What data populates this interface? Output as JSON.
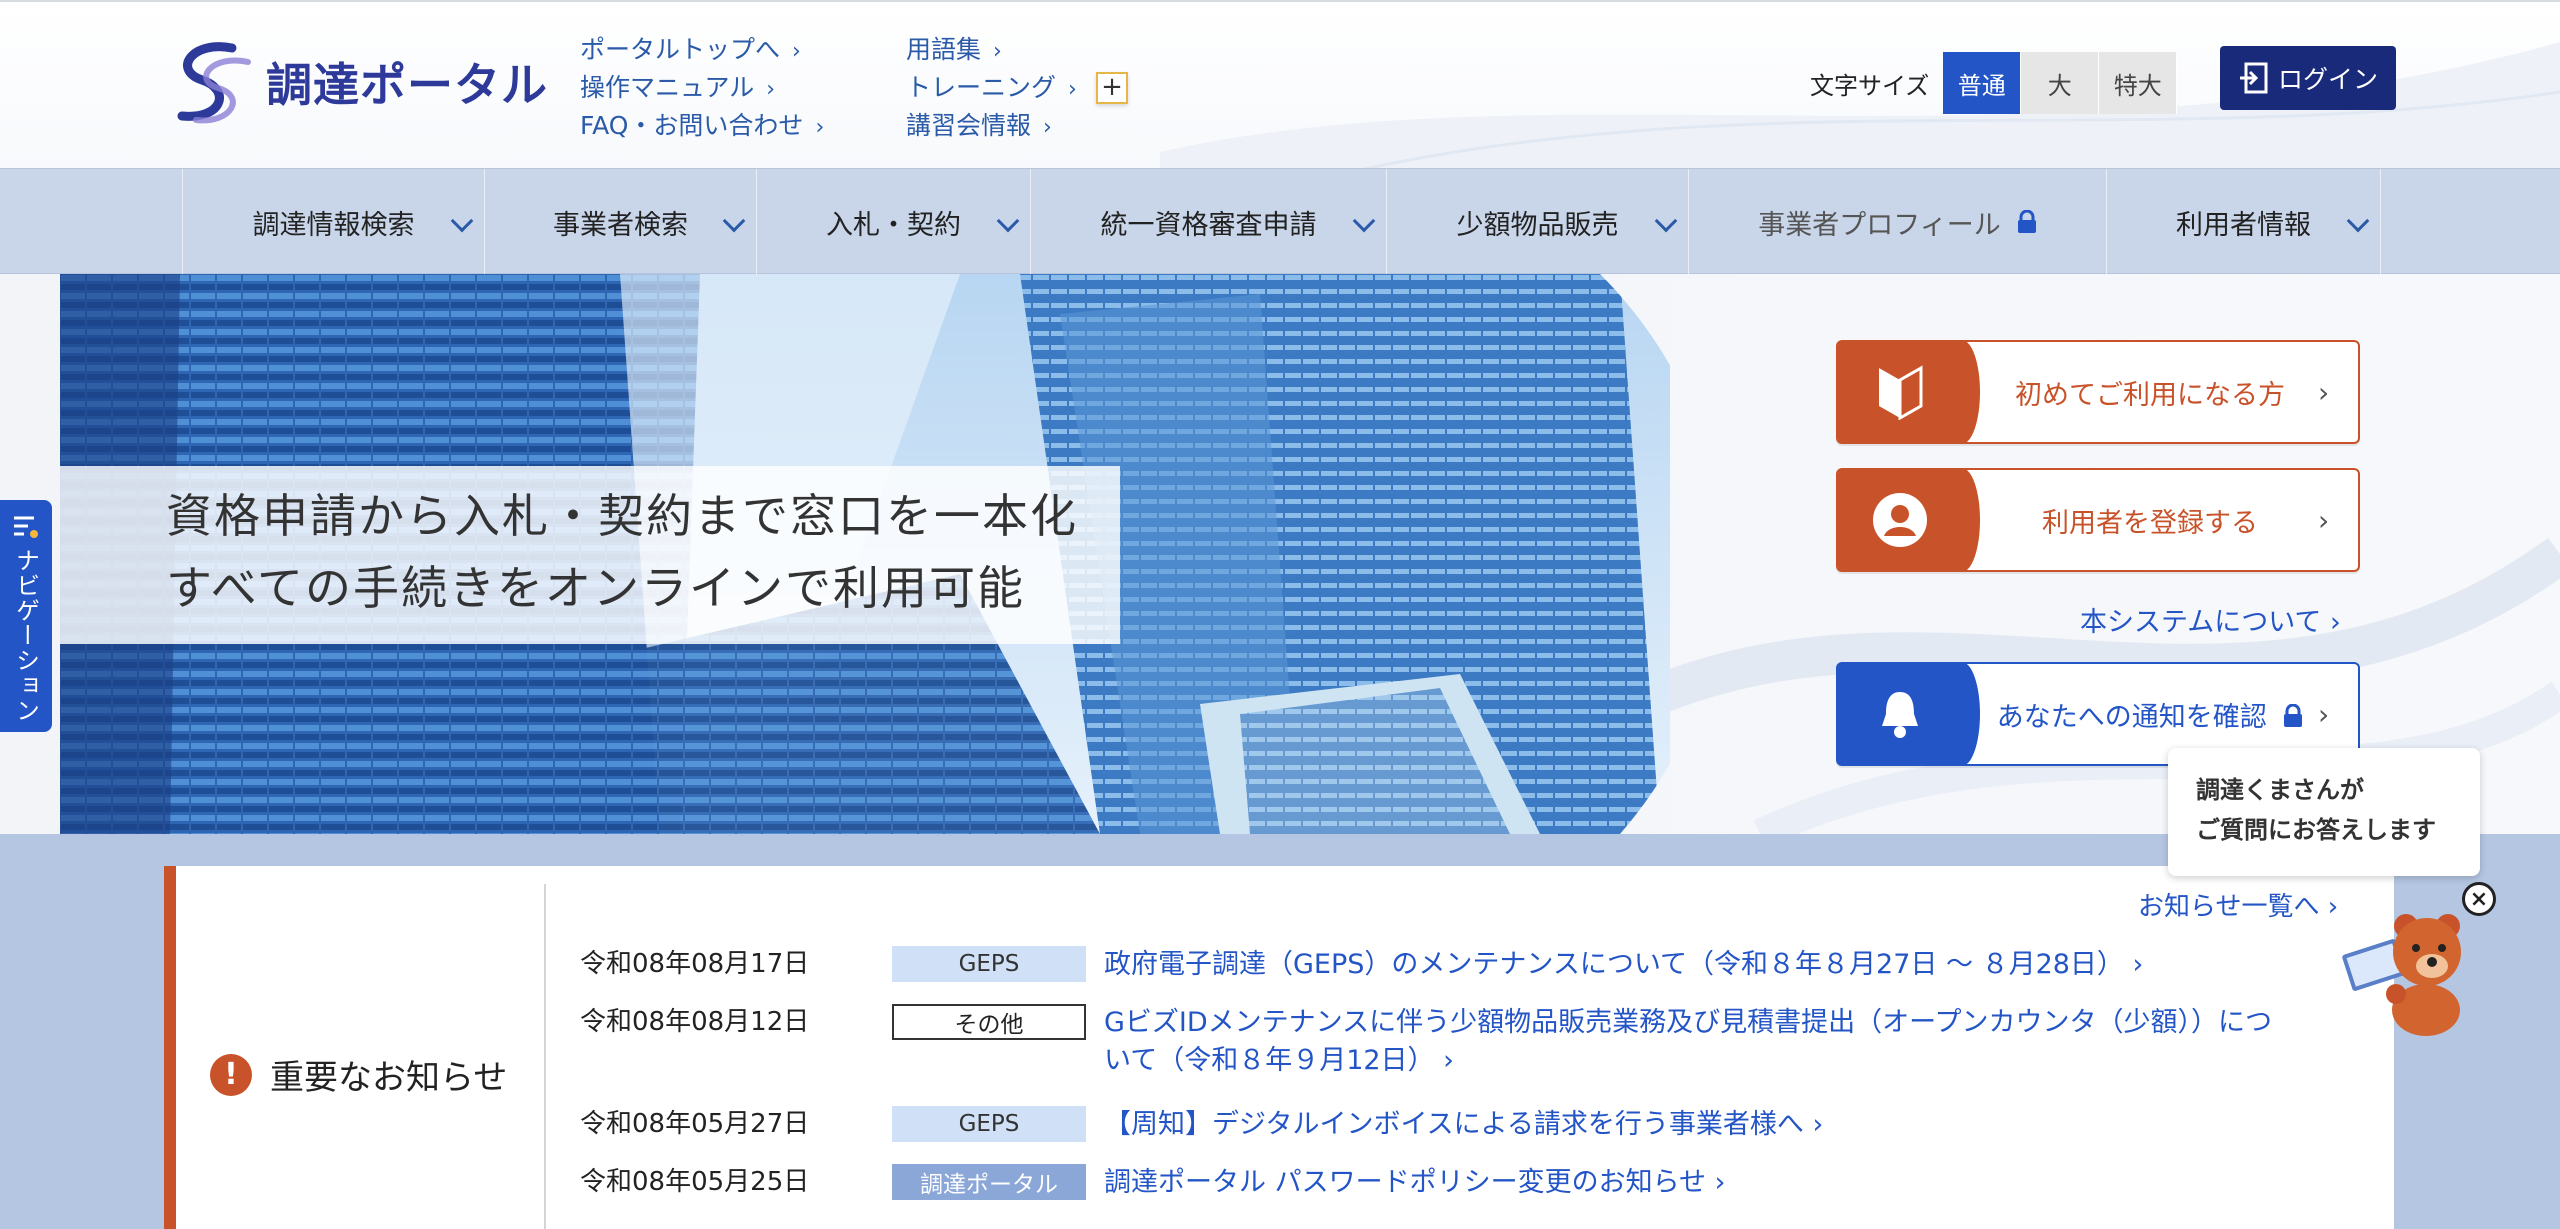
{
  "header": {
    "logo_text": "調達ポータル",
    "links_col1": [
      "ポータルトップへ",
      "操作マニュアル",
      "FAQ・お問い合わせ"
    ],
    "links_col2": [
      "用語集",
      "トレーニング",
      "講習会情報"
    ],
    "plus_label": "+",
    "font_size_label": "文字サイズ",
    "font_size_options": [
      "普通",
      "大",
      "特大"
    ],
    "login_label": "ログイン"
  },
  "nav": {
    "items": [
      "調達情報検索",
      "事業者検索",
      "入札・契約",
      "統一資格審査申請",
      "少額物品販売",
      "事業者プロフィール",
      "利用者情報"
    ]
  },
  "hero": {
    "line1": "資格申請から入札・契約まで窓口を一本化",
    "line2": "すべての手続きをオンラインで利用可能"
  },
  "side_nav": {
    "label": "ナビゲーション"
  },
  "actions": {
    "first_time": "初めてご利用になる方",
    "register": "利用者を登録する",
    "about": "本システムについて",
    "notifications": "あなたへの通知を確認"
  },
  "assistant": {
    "line1": "調達くまさんが",
    "line2": "ご質問にお答えします",
    "close": "×"
  },
  "news": {
    "heading": "重要なお知らせ",
    "view_all": "お知らせ一覧へ",
    "items": [
      {
        "date": "令和08年08月17日",
        "tag": "GEPS",
        "title": "政府電子調達（GEPS）のメンテナンスについて（令和８年８月27日 〜 ８月28日）"
      },
      {
        "date": "令和08年08月12日",
        "tag": "その他",
        "title": "GビズIDメンテナンスに伴う少額物品販売業務及び見積書提出（オープンカウンタ（少額））について（令和８年９月12日）"
      },
      {
        "date": "令和08年05月27日",
        "tag": "GEPS",
        "title": "【周知】デジタルインボイスによる請求を行う事業者様へ"
      },
      {
        "date": "令和08年05月25日",
        "tag": "調達ポータル",
        "title": "調達ポータル パスワードポリシー変更のお知らせ"
      }
    ]
  },
  "colors": {
    "brand_blue": "#2355c6",
    "navy": "#1a2a7a",
    "accent_orange": "#c8532a",
    "nav_bg": "#c9d6ea"
  }
}
